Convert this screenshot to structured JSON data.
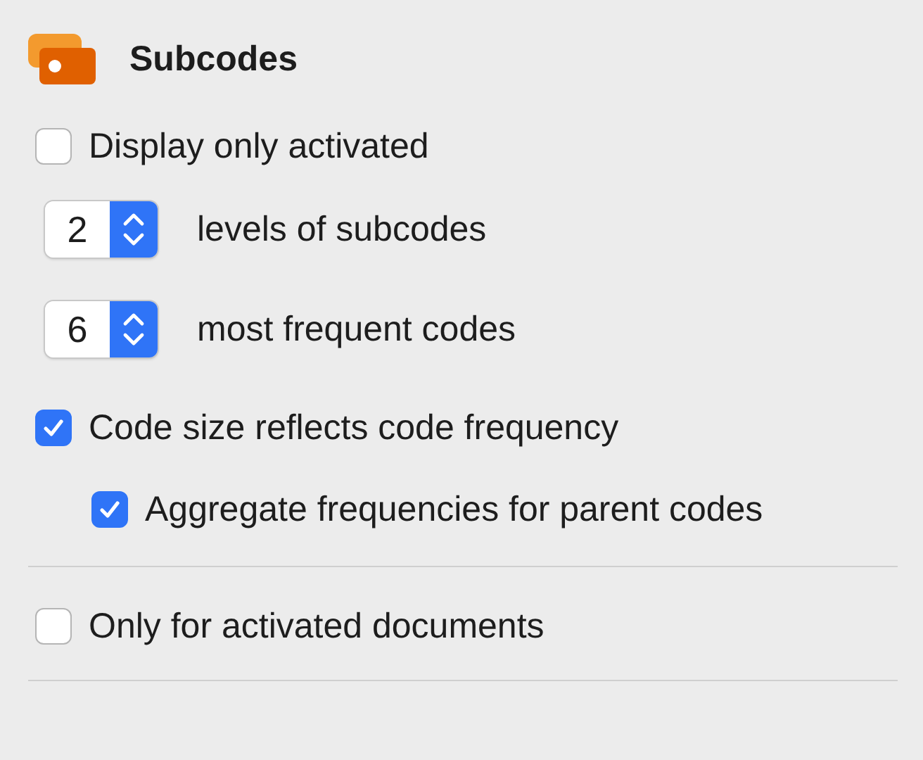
{
  "header": {
    "title": "Subcodes"
  },
  "items": [
    {
      "kind": "checkbox",
      "label": "Display only activated",
      "checked": false
    },
    {
      "kind": "stepper",
      "number": "2",
      "label": "levels of subcodes"
    },
    {
      "kind": "stepper",
      "number": "6",
      "label": "most frequent codes"
    },
    {
      "kind": "checkbox",
      "label": "Code size reflects code frequency",
      "checked": true,
      "children": [
        {
          "kind": "checkbox",
          "label": "Aggregate frequencies for parent codes",
          "checked": true
        }
      ]
    },
    {
      "kind": "divider"
    },
    {
      "kind": "checkbox",
      "label": "Only for activated documents",
      "checked": false
    },
    {
      "kind": "divider"
    }
  ]
}
